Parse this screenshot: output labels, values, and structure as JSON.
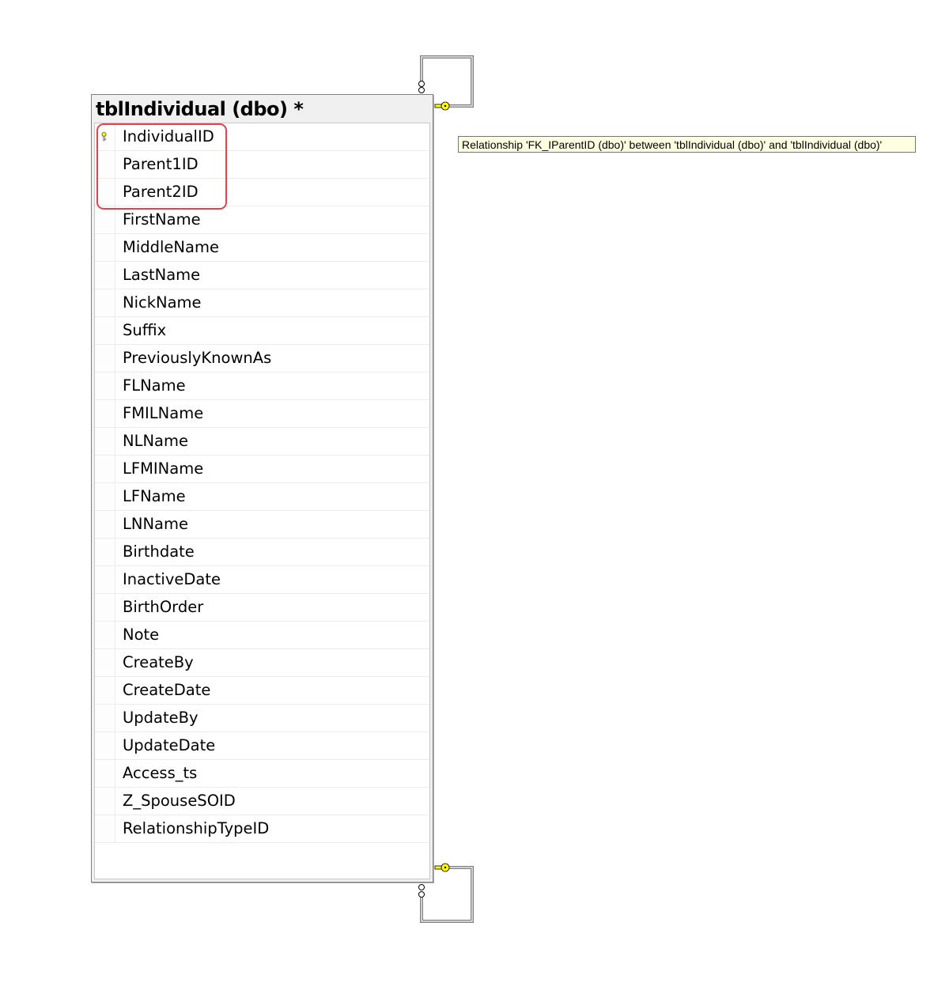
{
  "table": {
    "title": "tblIndividual (dbo) *",
    "columns": [
      {
        "name": "IndividualID",
        "primary_key": true
      },
      {
        "name": "Parent1ID"
      },
      {
        "name": "Parent2ID"
      },
      {
        "name": "FirstName"
      },
      {
        "name": "MiddleName"
      },
      {
        "name": "LastName"
      },
      {
        "name": "NickName"
      },
      {
        "name": "Suffix"
      },
      {
        "name": "PreviouslyKnownAs"
      },
      {
        "name": "FLName"
      },
      {
        "name": "FMILName"
      },
      {
        "name": "NLName"
      },
      {
        "name": "LFMIName"
      },
      {
        "name": "LFName"
      },
      {
        "name": "LNName"
      },
      {
        "name": "Birthdate"
      },
      {
        "name": "InactiveDate"
      },
      {
        "name": "BirthOrder"
      },
      {
        "name": "Note"
      },
      {
        "name": "CreateBy"
      },
      {
        "name": "CreateDate"
      },
      {
        "name": "UpdateBy"
      },
      {
        "name": "UpdateDate"
      },
      {
        "name": "Access_ts"
      },
      {
        "name": "Z_SpouseSOID"
      },
      {
        "name": "RelationshipTypeID"
      }
    ]
  },
  "tooltip": "Relationship 'FK_IParentID (dbo)' between 'tblIndividual (dbo)' and 'tblIndividual (dbo)'",
  "colors": {
    "highlight": "#e8414b",
    "key": "#ffff00",
    "tooltip_bg": "#ffffe1"
  }
}
